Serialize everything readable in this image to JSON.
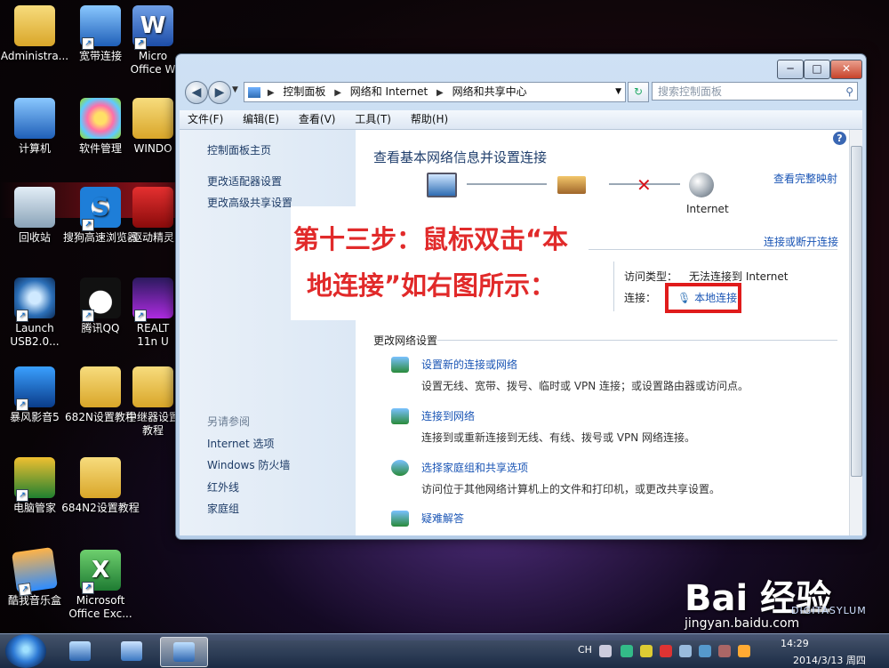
{
  "desktop": {
    "icons": [
      {
        "label": "Administra...",
        "glyph": "user-folder-icon"
      },
      {
        "label": "宽带连接",
        "glyph": "broadband-connection-icon"
      },
      {
        "label": "Micro Office W",
        "glyph": "word-icon"
      },
      {
        "label": "计算机",
        "glyph": "computer-icon"
      },
      {
        "label": "软件管理",
        "glyph": "software-manager-icon"
      },
      {
        "label": "WINDO",
        "glyph": "folder-icon"
      },
      {
        "label": "回收站",
        "glyph": "recycle-bin-icon"
      },
      {
        "label": "搜狗高速浏览器",
        "glyph": "sogou-browser-icon"
      },
      {
        "label": "驱动精灵",
        "glyph": "driver-genius-icon"
      },
      {
        "label": "Launch USB2.0...",
        "glyph": "launch-usb-icon"
      },
      {
        "label": "腾讯QQ",
        "glyph": "qq-icon"
      },
      {
        "label": "REALT 11n U",
        "glyph": "realtek-icon"
      },
      {
        "label": "暴风影音5",
        "glyph": "baofeng-player-icon"
      },
      {
        "label": "682N设置教程",
        "glyph": "folder-icon"
      },
      {
        "label": "中继器设置教程",
        "glyph": "folder-icon"
      },
      {
        "label": "电脑管家",
        "glyph": "pc-manager-icon"
      },
      {
        "label": "684N2设置教程",
        "glyph": "folder-icon"
      },
      {
        "label": "酷我音乐盒",
        "glyph": "kuwo-music-icon"
      },
      {
        "label": "Microsoft Office Exc...",
        "glyph": "excel-icon"
      }
    ]
  },
  "window": {
    "controls": {
      "minimize": "─",
      "maximize": "□",
      "close": "✕"
    },
    "breadcrumb": [
      "控制面板",
      "网络和 Internet",
      "网络和共享中心"
    ],
    "search_placeholder": "搜索控制面板",
    "menu": [
      "文件(F)",
      "编辑(E)",
      "查看(V)",
      "工具(T)",
      "帮助(H)"
    ],
    "left_pane": {
      "items": [
        "控制面板主页",
        "更改适配器设置",
        "更改高级共享设置"
      ],
      "see_also_title": "另请参阅",
      "see_also": [
        "Internet 选项",
        "Windows 防火墙",
        "红外线",
        "家庭组"
      ]
    },
    "main": {
      "title": "查看基本网络信息并设置连接",
      "view_full_map": "查看完整映射",
      "internet_label": "Internet",
      "connect_disconnect": "连接或断开连接",
      "access_type_label": "访问类型：",
      "access_type_value": "无法连接到 Internet",
      "connection_label": "连接：",
      "connection_value": "本地连接",
      "change_settings_title": "更改网络设置",
      "tasks": [
        {
          "link": "设置新的连接或网络",
          "desc": "设置无线、宽带、拨号、临时或 VPN 连接；或设置路由器或访问点。"
        },
        {
          "link": "连接到网络",
          "desc": "连接到或重新连接到无线、有线、拨号或 VPN 网络连接。"
        },
        {
          "link": "选择家庭组和共享选项",
          "desc": "访问位于其他网络计算机上的文件和打印机，或更改共享设置。"
        },
        {
          "link": "疑难解答",
          "desc": ""
        }
      ]
    }
  },
  "overlay": {
    "line1": "第十三步：鼠标双击“本",
    "line2": "地连接”如右图所示："
  },
  "taskbar": {
    "tray_lang": "CH",
    "time": "14:29",
    "date": "2014/3/13 周四"
  },
  "watermark": {
    "brand": "Bai 经验",
    "url": "jingyan.baidu.com",
    "tag": "DIGITASYLUM"
  },
  "colors": {
    "highlight": "#e01b1b",
    "overlay_text": "#e12a2a",
    "link": "#1a55b5"
  }
}
